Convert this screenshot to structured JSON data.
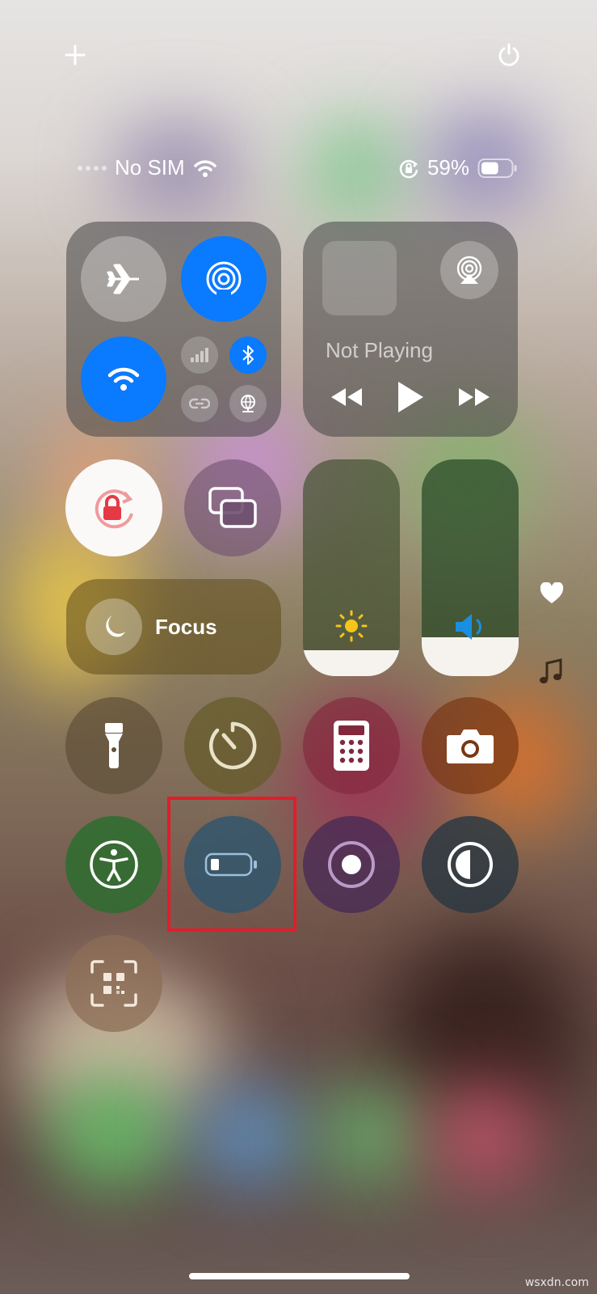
{
  "status_bar": {
    "carrier": "No SIM",
    "battery_percent": "59%",
    "battery_level": 0.59
  },
  "top_bar": {
    "add_icon": "plus-icon",
    "power_icon": "power-icon"
  },
  "connectivity": {
    "airplane_mode": false,
    "airdrop": true,
    "wifi": true,
    "cellular": false,
    "bluetooth": true,
    "personal_hotspot": false,
    "vpn": false
  },
  "media": {
    "title": "Not Playing",
    "controls": [
      "rewind-icon",
      "play-icon",
      "fast-forward-icon"
    ]
  },
  "brightness": {
    "level": 0.12
  },
  "volume": {
    "level": 0.18
  },
  "focus": {
    "label": "Focus"
  },
  "controls": [
    "orientation-lock-icon",
    "screen-mirroring-icon",
    "flashlight-icon",
    "timer-icon",
    "calculator-icon",
    "camera-icon",
    "accessibility-icon",
    "low-power-mode-icon",
    "screen-recording-icon",
    "dark-mode-icon",
    "code-scanner-icon"
  ],
  "side": [
    "heart-icon",
    "music-note-icon"
  ],
  "colors": {
    "accent_blue": "#0a7aff",
    "highlight_red": "#e01e2a"
  },
  "watermark": "wsxdn.com"
}
